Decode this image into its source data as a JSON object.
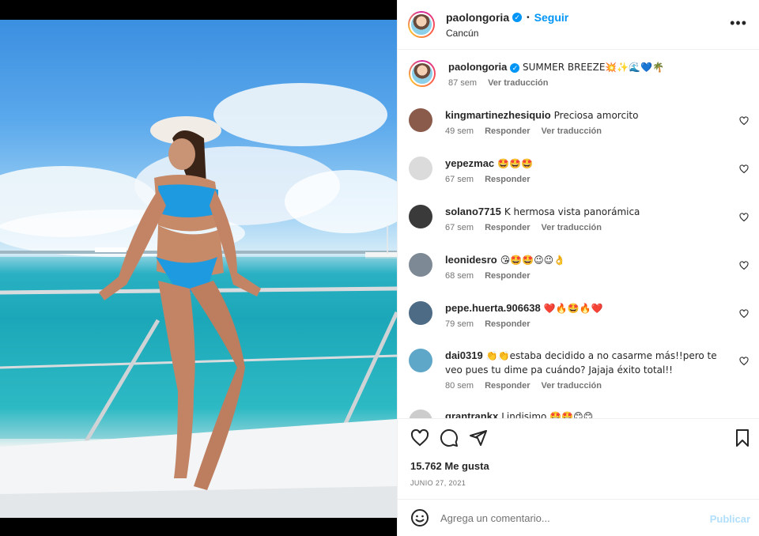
{
  "post": {
    "username": "paolongoria",
    "follow_label": "Seguir",
    "location": "Cancún",
    "verified_mark": "✓",
    "more_label": "•••"
  },
  "caption": {
    "username": "paolongoria",
    "text": "SUMMER BREEZE💥✨🌊💙🌴",
    "age": "87 sem",
    "translate": "Ver traducción"
  },
  "comments": [
    {
      "username": "kingmartinezhesiquio",
      "text": "Preciosa amorcito",
      "age": "49 sem",
      "reply": "Responder",
      "translate": "Ver traducción",
      "avatar_color": "#8a5a4a"
    },
    {
      "username": "yepezmac",
      "text": "🤩🤩🤩",
      "age": "67 sem",
      "reply": "Responder",
      "translate": "",
      "avatar_color": "#dbdbdb"
    },
    {
      "username": "solano7715",
      "text": "K hermosa vista panorámica",
      "age": "67 sem",
      "reply": "Responder",
      "translate": "Ver traducción",
      "avatar_color": "#3a3a3a"
    },
    {
      "username": "leonidesro",
      "text": "😘🤩🤩😉😉👌",
      "age": "68 sem",
      "reply": "Responder",
      "translate": "",
      "avatar_color": "#7d8a96"
    },
    {
      "username": "pepe.huerta.906638",
      "text": "❤️🔥🤩🔥❤️",
      "age": "79 sem",
      "reply": "Responder",
      "translate": "",
      "avatar_color": "#4e6b86"
    },
    {
      "username": "dai0319",
      "text": "👏👏estaba decidido a no casarme más!!pero te veo pues tu dime pa cuándo? Jajaja éxito total!!",
      "age": "80 sem",
      "reply": "Responder",
      "translate": "Ver traducción",
      "avatar_color": "#5ea7c9"
    },
    {
      "username": "grantrankx",
      "text": "Lindisimo 🤩🤩😊😊",
      "age": "",
      "reply": "",
      "translate": "",
      "avatar_color": "#cccccc"
    }
  ],
  "stats": {
    "likes": "15.762 Me gusta",
    "date": "JUNIO 27, 2021"
  },
  "composer": {
    "placeholder": "Agrega un comentario...",
    "publish": "Publicar"
  },
  "colors": {
    "accent": "#0095f6",
    "publish_disabled": "#b2dffc",
    "muted_text": "#737373"
  },
  "icons": [
    "like-icon",
    "comment-icon",
    "share-icon",
    "save-icon",
    "emoji-icon",
    "heart-icon",
    "more-icon",
    "verified-icon"
  ]
}
